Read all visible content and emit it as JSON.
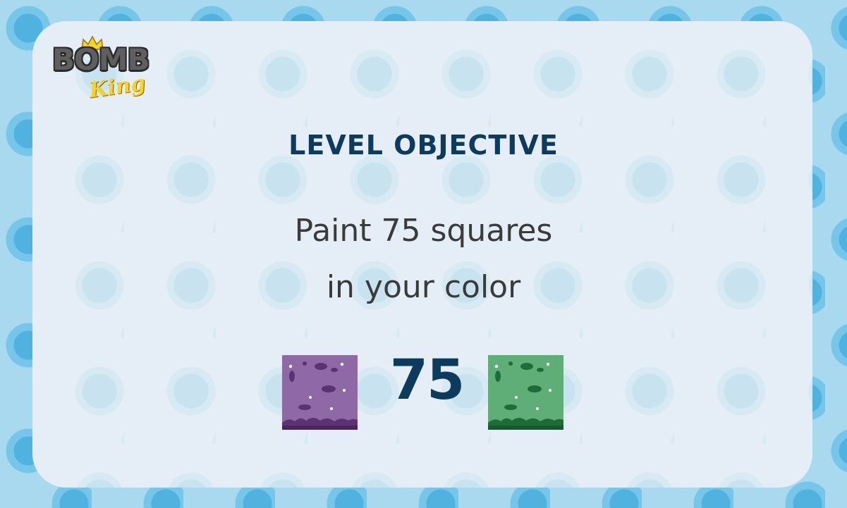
{
  "logo": {
    "word": "BOMB",
    "sub": "King"
  },
  "objective": {
    "title": "LEVEL OBJECTIVE",
    "line1": "Paint 75 squares",
    "line2": "in your color",
    "count": "75"
  },
  "tiles": [
    {
      "name": "purple",
      "color": "#8f69a6",
      "dark": "#5b3272"
    },
    {
      "name": "green",
      "color": "#5fae78",
      "dark": "#1f6b3a"
    }
  ]
}
